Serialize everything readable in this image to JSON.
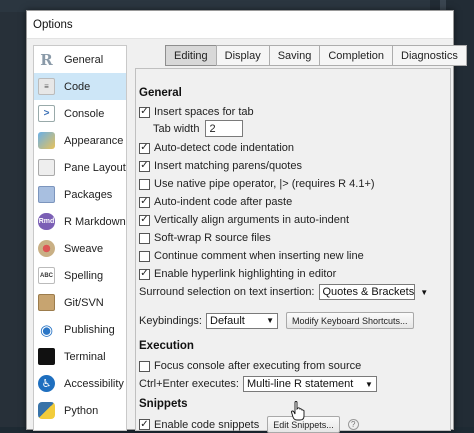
{
  "window": {
    "title": "Options"
  },
  "sidebar": {
    "items": [
      {
        "label": "General",
        "active": false
      },
      {
        "label": "Code",
        "active": true
      },
      {
        "label": "Console",
        "active": false
      },
      {
        "label": "Appearance",
        "active": false
      },
      {
        "label": "Pane Layout",
        "active": false
      },
      {
        "label": "Packages",
        "active": false
      },
      {
        "label": "R Markdown",
        "active": false
      },
      {
        "label": "Sweave",
        "active": false
      },
      {
        "label": "Spelling",
        "active": false
      },
      {
        "label": "Git/SVN",
        "active": false
      },
      {
        "label": "Publishing",
        "active": false
      },
      {
        "label": "Terminal",
        "active": false
      },
      {
        "label": "Accessibility",
        "active": false
      },
      {
        "label": "Python",
        "active": false
      }
    ],
    "icon_glyphs": {
      "general": "R",
      "code": "≡",
      "console": ">",
      "rmarkdown": "Rmd",
      "spelling": "ABC",
      "publishing": "◉",
      "accessibility": "♿"
    }
  },
  "tabs": [
    {
      "label": "Editing",
      "active": true
    },
    {
      "label": "Display",
      "active": false
    },
    {
      "label": "Saving",
      "active": false
    },
    {
      "label": "Completion",
      "active": false
    },
    {
      "label": "Diagnostics",
      "active": false
    }
  ],
  "general": {
    "title": "General",
    "insert_spaces": {
      "label": "Insert spaces for tab",
      "checked": true
    },
    "tab_width": {
      "label": "Tab width",
      "value": "2"
    },
    "auto_detect": {
      "label": "Auto-detect code indentation",
      "checked": true
    },
    "matching_parens": {
      "label": "Insert matching parens/quotes",
      "checked": true
    },
    "native_pipe": {
      "label": "Use native pipe operator, |> (requires R 4.1+)",
      "checked": false
    },
    "auto_indent": {
      "label": "Auto-indent code after paste",
      "checked": true
    },
    "vertically_align": {
      "label": "Vertically align arguments in auto-indent",
      "checked": true
    },
    "soft_wrap": {
      "label": "Soft-wrap R source files",
      "checked": false
    },
    "continue_comment": {
      "label": "Continue comment when inserting new line",
      "checked": false
    },
    "hyperlink": {
      "label": "Enable hyperlink highlighting in editor",
      "checked": true
    },
    "surround": {
      "label": "Surround selection on text insertion:",
      "value": "Quotes & Brackets"
    },
    "keybindings": {
      "label": "Keybindings:",
      "value": "Default",
      "modify_label": "Modify Keyboard Shortcuts..."
    }
  },
  "execution": {
    "title": "Execution",
    "focus_console": {
      "label": "Focus console after executing from source",
      "checked": false
    },
    "ctrl_enter": {
      "label": "Ctrl+Enter executes:",
      "value": "Multi-line R statement"
    }
  },
  "snippets": {
    "title": "Snippets",
    "enable": {
      "label": "Enable code snippets",
      "checked": true
    },
    "edit_label": "Edit Snippets...",
    "help_glyph": "?"
  },
  "check_glyph": "✓",
  "dropdown_glyph": "▼"
}
